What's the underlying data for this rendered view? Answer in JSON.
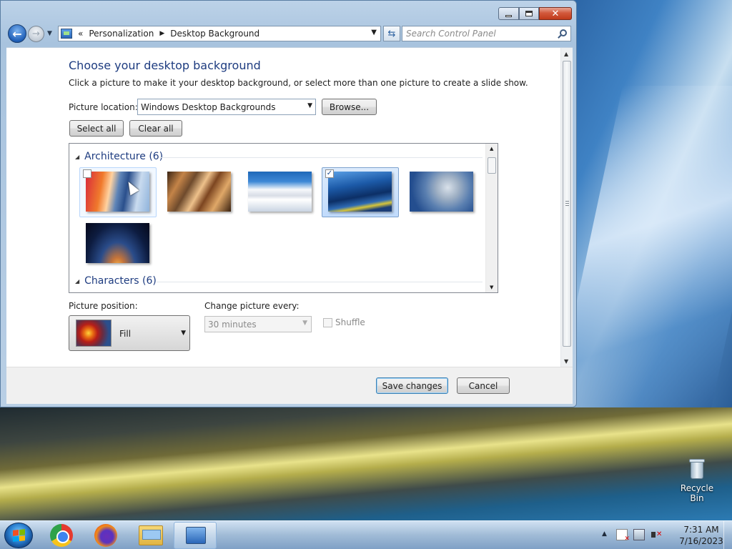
{
  "window": {
    "nav": {
      "back_glyph": "←",
      "forward_glyph": "→",
      "breadcrumb": [
        "Personalization",
        "Desktop Background"
      ],
      "breadcrumb_prefix": "«",
      "search_placeholder": "Search Control Panel"
    },
    "heading": "Choose your desktop background",
    "subheading": "Click a picture to make it your desktop background, or select more than one picture to create a slide show.",
    "picture_location": {
      "label": "Picture location:",
      "value": "Windows Desktop Backgrounds",
      "browse_label": "Browse..."
    },
    "select_all_label": "Select all",
    "clear_all_label": "Clear all",
    "groups": [
      {
        "title": "Architecture (6)",
        "expanded": true,
        "pictures": [
          {
            "checked": false,
            "state": "hover"
          },
          {
            "checked": false,
            "state": "normal"
          },
          {
            "checked": false,
            "state": "normal"
          },
          {
            "checked": true,
            "state": "selected"
          },
          {
            "checked": false,
            "state": "normal"
          },
          {
            "checked": false,
            "state": "normal"
          }
        ]
      },
      {
        "title": "Characters (6)",
        "expanded": true
      }
    ],
    "picture_position": {
      "label": "Picture position:",
      "value": "Fill"
    },
    "change_picture": {
      "label": "Change picture every:",
      "value": "30 minutes",
      "enabled": false
    },
    "shuffle": {
      "label": "Shuffle",
      "checked": false,
      "enabled": false
    },
    "save_label": "Save changes",
    "cancel_label": "Cancel",
    "caption": {
      "close_glyph": "✕"
    }
  },
  "desktop": {
    "recycle_bin_label": "Recycle Bin"
  },
  "taskbar": {
    "pinned": [
      "chrome-icon",
      "firefox-icon",
      "file-explorer-icon",
      "control-panel-icon"
    ],
    "clock_time": "7:31 AM",
    "clock_date": "7/16/2023"
  },
  "colors": {
    "heading": "#1e3c80",
    "selection_border": "#7da2ce",
    "close_button": "#c03a1a"
  }
}
